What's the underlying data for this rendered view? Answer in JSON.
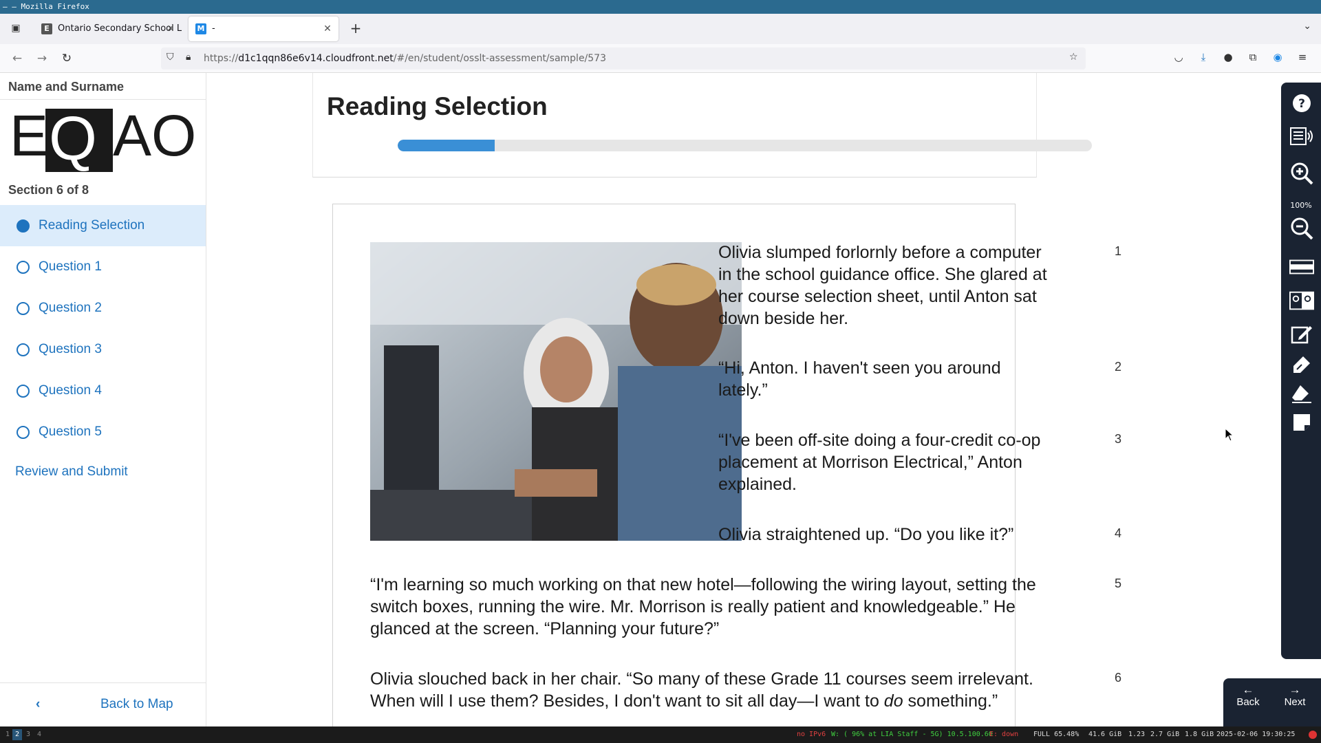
{
  "os": {
    "window_title": "– – Mozilla Firefox"
  },
  "browser": {
    "tabs": [
      {
        "label": "Ontario Secondary School L",
        "favicon": "eqao"
      },
      {
        "label": "-",
        "favicon": "M"
      }
    ],
    "url_prefix": "https://",
    "url_host": "d1c1qqn86e6v14.cloudfront.net",
    "url_path": "/#/en/student/osslt-assessment/sample/573"
  },
  "sidebar": {
    "student_name": "Name and Surname",
    "logo_text": "EQAO",
    "section": "Section 6 of 8",
    "items": [
      {
        "label": "Reading Selection",
        "active": true
      },
      {
        "label": "Question 1",
        "active": false
      },
      {
        "label": "Question 2",
        "active": false
      },
      {
        "label": "Question 3",
        "active": false
      },
      {
        "label": "Question 4",
        "active": false
      },
      {
        "label": "Question 5",
        "active": false
      }
    ],
    "review": "Review and Submit",
    "back_to_map": "Back to Map"
  },
  "main": {
    "title": "Reading Selection",
    "progress_fraction": 0.14,
    "paragraphs": [
      {
        "num": "1",
        "text": "Olivia slumped forlornly before a computer in the school guidance office. She glared at her course selection sheet, until Anton sat down beside her."
      },
      {
        "num": "2",
        "text": "“Hi, Anton. I haven't seen you around lately.”"
      },
      {
        "num": "3",
        "text": "“I've been off-site doing a four-credit co-op placement at Morrison Electrical,” Anton explained."
      },
      {
        "num": "4",
        "text": "Olivia straightened up. “Do you like it?”"
      },
      {
        "num": "5",
        "text": "“I'm learning so much working on that new hotel—following the wiring layout, setting the switch boxes, running the wire. Mr. Morrison is really patient and knowledgeable.” He glanced at the screen. “Planning your future?”"
      },
      {
        "num": "6",
        "text_a": "Olivia slouched back in her chair. “So many of these Grade 11 courses seem irrelevant. When will I use them? Besides, I don't want to sit all day—I want to ",
        "text_em": "do",
        "text_b": " something.”"
      }
    ]
  },
  "toolbar": {
    "zoom_level": "100%",
    "tools": [
      "help-icon",
      "text-to-speech-icon",
      "zoom-in-icon",
      "zoom-out-icon",
      "line-reader-icon",
      "contrast-icon",
      "notepad-icon",
      "highlighter-icon",
      "eraser-icon",
      "sticky-note-icon"
    ],
    "back_label": "Back",
    "next_label": "Next"
  },
  "statusbar": {
    "workspaces": [
      "1",
      "2",
      "3",
      "4"
    ],
    "current_workspace": "2",
    "ipv6": "no IPv6",
    "wifi": "W: ( 96% at LIA Staff - 5G) 10.5.100.60",
    "eth": "E: down",
    "battery": "FULL 65.48%",
    "disk": "41.6 GiB",
    "load": "1.23",
    "mem": "2.7 GiB",
    "swap": "1.8 GiB",
    "datetime": "2025-02-06 19:30:25",
    "colors": {
      "ipv6": "#e04040",
      "wifi": "#40d040",
      "eth": "#e04040"
    }
  }
}
